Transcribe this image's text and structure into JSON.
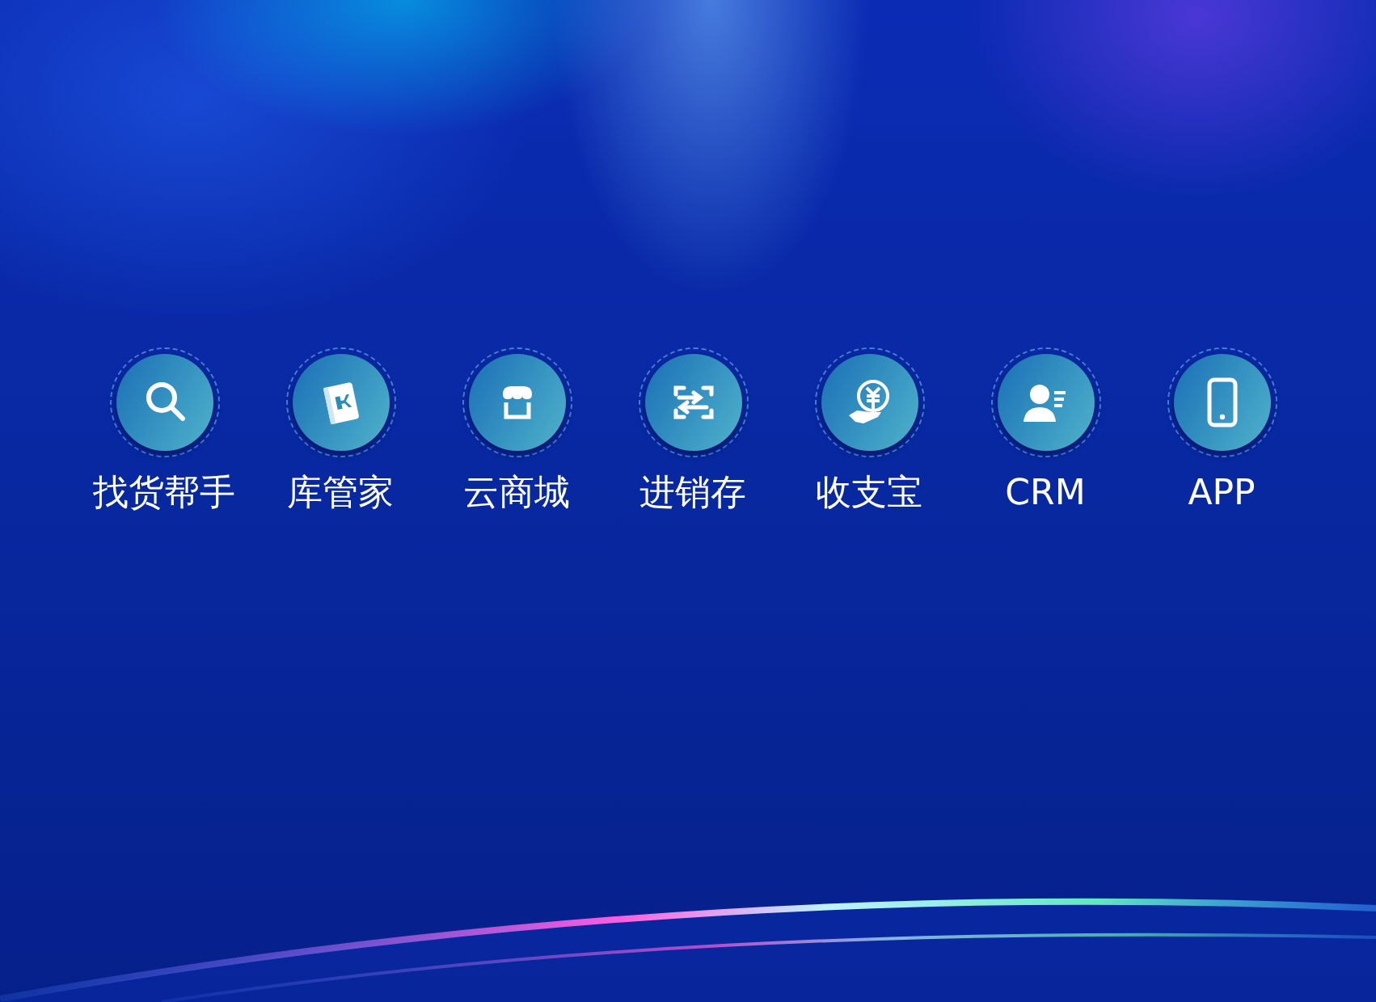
{
  "apps": [
    {
      "label": "找货帮手",
      "kind": "search"
    },
    {
      "label": "库管家",
      "kind": "book"
    },
    {
      "label": "云商城",
      "kind": "store"
    },
    {
      "label": "进销存",
      "kind": "transfer"
    },
    {
      "label": "收支宝",
      "kind": "money"
    },
    {
      "label": "CRM",
      "kind": "contact"
    },
    {
      "label": "APP",
      "kind": "phone"
    }
  ]
}
